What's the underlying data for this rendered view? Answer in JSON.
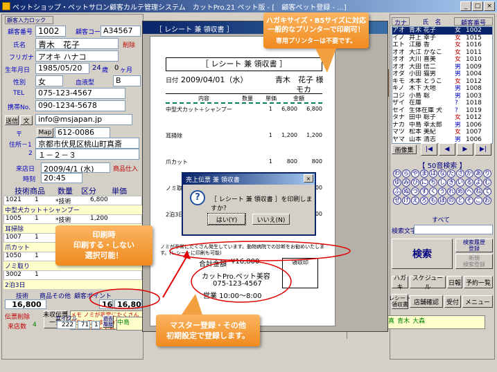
{
  "window": {
    "title": "ペットショップ・ペットサロン顧客カルテ管理システム　カットPro.21 ペット版 - [　顧客ペット登録 - ...]",
    "min": "_",
    "max": "□",
    "close": "×",
    "restore": "▫"
  },
  "customer": {
    "section_label": "顧客入力ロック",
    "number_label": "顧客番号",
    "number": "1002",
    "code_label": "顧客コード",
    "code": "A34567",
    "name_label": "氏名",
    "name": "青木　花子",
    "delete_label": "削除",
    "kana_label": "フリガナ",
    "kana": "アオキ ハナコ",
    "birth_label": "生年月日",
    "birth": "1985/05/20",
    "age": "24",
    "age_unit": "歳",
    "months": "0",
    "month_unit": "ヶ月",
    "sex_label": "性別",
    "sex": "女",
    "blood_label": "血液型",
    "blood": "B",
    "tel_label": "TEL",
    "tel": "075-123-4567",
    "mobile_label": "携帯No.",
    "mobile": "090-1234-5678",
    "send_label": "送信",
    "text_label": "文",
    "email": "info@msjapan.jp",
    "postal_label": "〒",
    "map_label": "Map",
    "postal": "612-0086",
    "address_label": "住所－1",
    "address1": "京都市伏見区桃山町真斎",
    "address2_label": "2",
    "address2": "１－２－３"
  },
  "visit": {
    "date_label": "来店日",
    "date": "2009/4/1 (水)",
    "time_label": "時刻",
    "time": "20:45",
    "product_label": "商品仕入",
    "col_tech": "技術商品",
    "col_qty": "数量",
    "col_cat": "区分",
    "col_price": "単価",
    "col_hide": "原"
  },
  "items": [
    {
      "code": "1021",
      "qty": "1",
      "cat": "*技術",
      "price": "6,800",
      "name": "中型犬カット＋シャンプー"
    },
    {
      "code": "1005",
      "qty": "1",
      "cat": "*技術",
      "price": "1,200",
      "name": "耳掃除"
    },
    {
      "code": "1007",
      "qty": "1",
      "cat": "*技術",
      "price": "800",
      "name": "爪カット"
    },
    {
      "code": "1050",
      "qty": "1",
      "cat": "*技術",
      "price": "",
      "name": "ノミ取り"
    },
    {
      "code": "3002",
      "qty": "1",
      "cat": "",
      "price": "",
      "name": "2泊3日"
    }
  ],
  "totals": {
    "tech_label": "技術",
    "product_label": "商品その他",
    "point_label": "顧客ポイント",
    "tech": "16,800",
    "points": "16",
    "total": "16,800",
    "delete_label": "伝票削除",
    "visits_label": "来店数",
    "visits": "4",
    "unissued_label": "未収伝票\n一覧",
    "memo_label": "メモ",
    "memo": "ノミが非常にたくさん発生していますので、動物病院での診断をお勧め..."
  },
  "cycle": {
    "label": "サイクル",
    "label2": "横綱日",
    "value1": "222",
    "value2": "71",
    "value3": "1",
    "badge": "過去\n履歴"
  },
  "receipt_window": {
    "title": "［ レシート 兼 領収書 ］",
    "heading": "［ レシート 兼 領収書 ］",
    "date_label": "日付",
    "date": "2009/04/01（水）",
    "customer": "青木　花子 様",
    "pet": "モカ",
    "col_item": "内容",
    "col_qty": "数量",
    "col_price": "単価",
    "col_amount": "金額",
    "lines": [
      {
        "item": "中型犬カット＋シャンプー",
        "qty": "1",
        "price": "6,800",
        "amount": "6,800"
      },
      {
        "item": "耳掃除",
        "qty": "1",
        "price": "1,200",
        "amount": "1,200"
      },
      {
        "item": "爪カット",
        "qty": "1",
        "price": "800",
        "amount": "800"
      },
      {
        "item": "ノミ取り",
        "qty": "1",
        "price": "2,000",
        "amount": "2,000"
      },
      {
        "item": "2泊3日",
        "qty": "1",
        "price": "6,000",
        "amount": "6,000"
      }
    ],
    "note": "ノミが非常にたくさん発生しています。動物病院での診断をお勧めいたします。(レシートに印刷も可能)",
    "total_label": "合計金額",
    "total": "¥16,800",
    "stamp_label": "領収印",
    "shop": "カットPro.ペット美容",
    "shop_tel": "075-123-4567",
    "hours": "営業 10:00～8:00"
  },
  "dialog": {
    "title": "売上伝票 兼 領収書",
    "message": "［ レシート 兼 領収書 ］を印刷しますか？",
    "yes": "はい(Y)",
    "no": "いいえ(N)"
  },
  "callouts": {
    "top": "ハガキサイズ・B5サイズに対応\n一般的なプリンターで印刷可！",
    "top2": "専用プリンターは不要です。",
    "left": "印刷時\n印刷する・しない\n選択可能！",
    "bottom": "マスター登録・その他\n初期設定で登録します。"
  },
  "list": {
    "col_kana": "カナ",
    "col_name": "氏　名",
    "col_no": "顧客番号",
    "rows": [
      {
        "kana": "アオ",
        "name": "青木 花子",
        "sex": "女",
        "no": "1002"
      },
      {
        "kana": "イノ",
        "name": "井上 幸子",
        "sex": "女",
        "no": "1015"
      },
      {
        "kana": "エト",
        "name": "江藤 香",
        "sex": "女",
        "no": "1016"
      },
      {
        "kana": "オオ",
        "name": "大江 かなこ",
        "sex": "女",
        "no": "1011"
      },
      {
        "kana": "オオ",
        "name": "大川 喜美",
        "sex": "女",
        "no": "1010"
      },
      {
        "kana": "オオ",
        "name": "大田 信二",
        "sex": "男",
        "no": "1009"
      },
      {
        "kana": "オダ",
        "name": "小田 猫男",
        "sex": "男",
        "no": "1004"
      },
      {
        "kana": "キモ",
        "name": "木本 とうこ",
        "sex": "女",
        "no": "1012"
      },
      {
        "kana": "キノ",
        "name": "木下 大地",
        "sex": "男",
        "no": "1008"
      },
      {
        "kana": "コジ",
        "name": "小島 聡",
        "sex": "男",
        "no": "1003"
      },
      {
        "kana": "ザイ",
        "name": "在庫",
        "sex": "?",
        "no": "1018"
      },
      {
        "kana": "セイ",
        "name": "生体在庫 犬",
        "sex": "?",
        "no": "1019"
      },
      {
        "kana": "タナ",
        "name": "田中 聡子",
        "sex": "女",
        "no": "1012"
      },
      {
        "kana": "ナカ",
        "name": "中島 幸太郎",
        "sex": "男",
        "no": "1006"
      },
      {
        "kana": "マツ",
        "name": "松本 美紀",
        "sex": "女",
        "no": "1007"
      },
      {
        "kana": "ヤマ",
        "name": "山本 清志",
        "sex": "男",
        "no": "1006"
      }
    ],
    "image_btn": "画像集",
    "first": "|◀",
    "prev": "◀",
    "next": "▶",
    "last": "▶|",
    "kana_title": "【 50音検索 】",
    "kana": [
      "わ",
      "ら",
      "や",
      "ま",
      "は",
      "な",
      "た",
      "さ",
      "か",
      "あ",
      "り",
      "ゆ",
      "み",
      "ひ",
      "に",
      "ち",
      "し",
      "き",
      "い",
      "る",
      "よ",
      "む",
      "ふ",
      "ぬ",
      "つ",
      "す",
      "く",
      "う",
      "れ",
      "め",
      "へ",
      "ね",
      "て",
      "せ",
      "け",
      "え",
      "ろ",
      "も",
      "ほ",
      "の",
      "と",
      "そ",
      "こ",
      "お"
    ],
    "all": "すべて",
    "search_label": "検索文字",
    "search": "検索",
    "reg_btn": "検索履歴\n登録",
    "new_btn": "新規\n検索登録",
    "hagaki": "ハガキ",
    "schedule": "スケジュール",
    "diary": "日報",
    "reserve": "予約一覧",
    "receipt": "レシート\n領収書",
    "shop_confirm": "店舗確認",
    "accept": "受付",
    "menu": "メニュー"
  },
  "bottom_names": {
    "cells": [
      "中島",
      "幸",
      "1011",
      "大江",
      "かな",
      "山田",
      "玲",
      "松本",
      "真",
      "青木",
      "花",
      "大森",
      "大"
    ]
  }
}
